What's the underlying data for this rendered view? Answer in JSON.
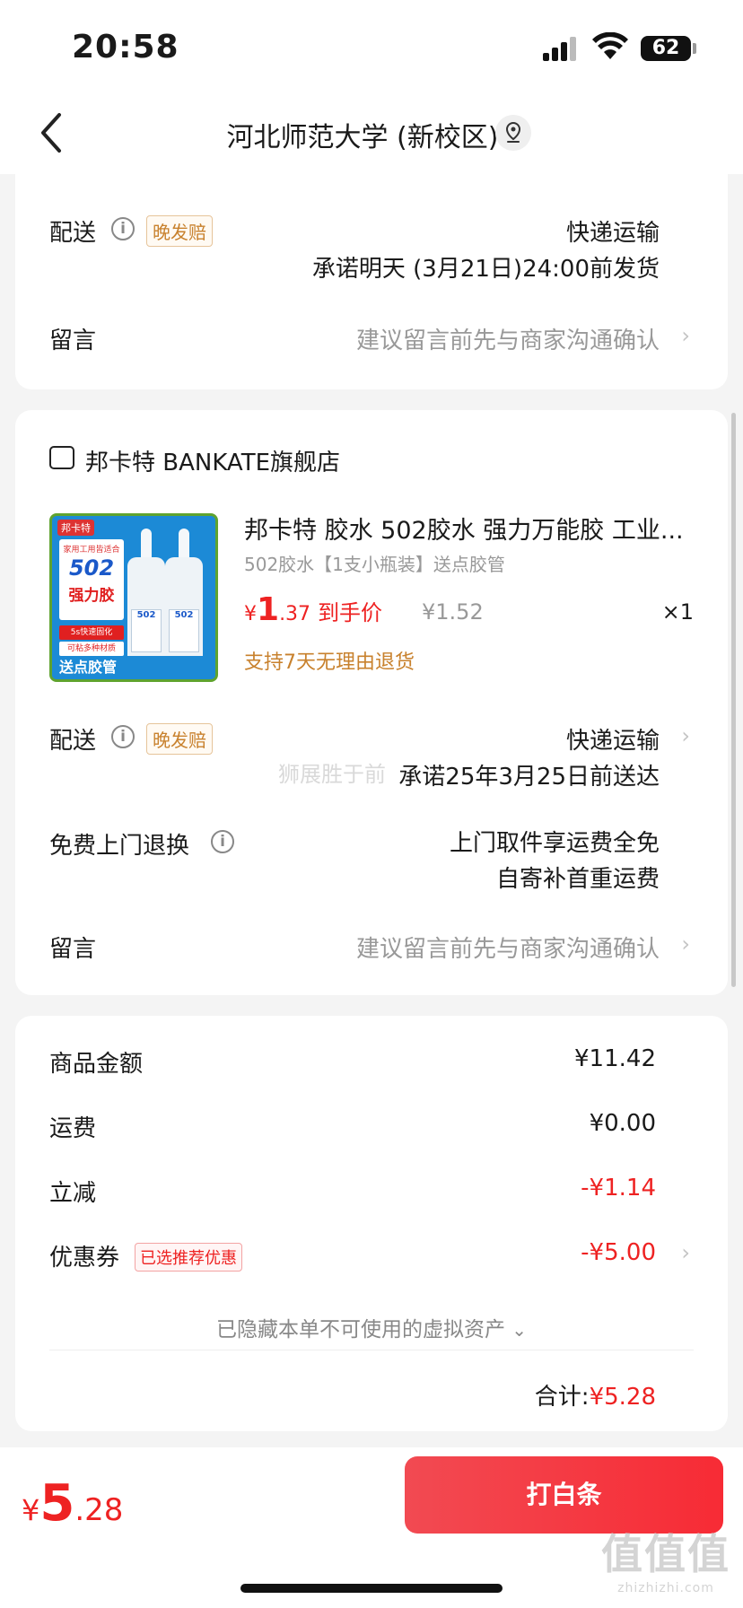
{
  "status_bar": {
    "time": "20:58",
    "battery": "62"
  },
  "nav": {
    "title": "河北师范大学 (新校区)"
  },
  "section1": {
    "delivery_label": "配送",
    "delivery_tag": "晚发赔",
    "delivery_method": "快递运输",
    "delivery_promise": "承诺明天 (3月21日)24:00前发货",
    "note_label": "留言",
    "note_hint": "建议留言前先与商家沟通确认"
  },
  "store": {
    "name": "邦卡特 BANKATE旗舰店",
    "product": {
      "title": "邦卡特 胶水 502胶水 强力万能胶 工业...",
      "sku": "502胶水【1支小瓶装】送点胶管",
      "price_currency": "¥",
      "price_int": "1",
      "price_dec": ".37",
      "price_label": "到手价",
      "original_price": "¥1.52",
      "quantity": "×1",
      "return_note": "支持7天无理由退货",
      "image": {
        "brand": "邦卡特",
        "box_sub": "家用工用皆适合",
        "box_code": "502",
        "box_big": "强力胶",
        "line1": "5s快速固化",
        "line2": "可粘多种材质",
        "bottle_code": "502",
        "footer": "送点胶管"
      }
    },
    "delivery_label": "配送",
    "delivery_tag": "晚发赔",
    "delivery_method": "快递运输",
    "delivery_promise": "承诺25年3月25日前送达",
    "return_label": "免费上门退换",
    "return_line1": "上门取件享运费全免",
    "return_line2": "自寄补首重运费",
    "note_label": "留言",
    "note_hint": "建议留言前先与商家沟通确认"
  },
  "summary": {
    "goods_label": "商品金额",
    "goods_value": "¥11.42",
    "shipping_label": "运费",
    "shipping_value": "¥0.00",
    "discount_label": "立减",
    "discount_value": "-¥1.14",
    "coupon_label": "优惠券",
    "coupon_tag": "已选推荐优惠",
    "coupon_value": "-¥5.00",
    "hidden_assets": "已隐藏本单不可使用的虚拟资产",
    "total_label": "合计:",
    "total_value": "¥5.28"
  },
  "bottom": {
    "currency": "¥",
    "price_int": "5",
    "price_dec": ".28",
    "pay_button": "打白条"
  },
  "watermark": {
    "text": "狮展胜于前",
    "corner_big": "值值值",
    "corner_small": "zhizhizhi.com"
  },
  "colors": {
    "accent": "#f2313b",
    "price_red": "#e22222",
    "tag_orange": "#c8812d"
  }
}
